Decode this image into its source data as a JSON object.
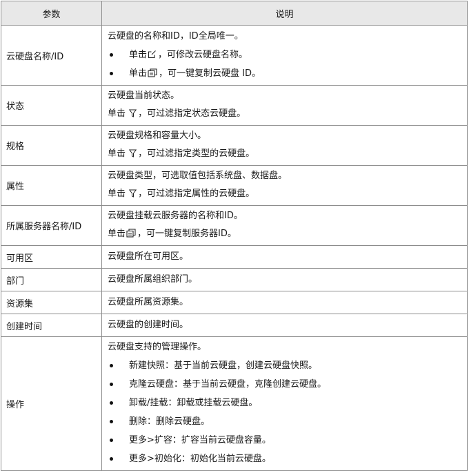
{
  "header": {
    "param": "参数",
    "desc": "说明"
  },
  "rows": [
    {
      "param": "云硬盘名称/ID",
      "lines": [
        {
          "text": "云硬盘的名称和ID，ID全局唯一。"
        }
      ],
      "bullets": [
        {
          "pre": "单击",
          "icon": "edit-icon",
          "post": "，可修改云硬盘名称。"
        },
        {
          "pre": "单击",
          "icon": "copy-icon",
          "post": "，可一键复制云硬盘 ID。"
        }
      ]
    },
    {
      "param": "状态",
      "lines": [
        {
          "text": "云硬盘当前状态。"
        },
        {
          "pre": "单击 ",
          "icon": "filter-icon",
          "post": "，可过滤指定状态云硬盘。"
        }
      ]
    },
    {
      "param": "规格",
      "lines": [
        {
          "text": "云硬盘规格和容量大小。"
        },
        {
          "pre": "单击 ",
          "icon": "filter-icon",
          "post": "，可过滤指定类型的云硬盘。"
        }
      ]
    },
    {
      "param": "属性",
      "lines": [
        {
          "text": "云硬盘类型，可选取值包括系统盘、数据盘。"
        },
        {
          "pre": "单击 ",
          "icon": "filter-icon",
          "post": "，可过滤指定属性的云硬盘。"
        }
      ]
    },
    {
      "param": "所属服务器名称/ID",
      "lines": [
        {
          "text": "云硬盘挂载云服务器的名称和ID。"
        },
        {
          "pre": "单击",
          "icon": "copy-icon",
          "post": "，可一键复制服务器ID。"
        }
      ]
    },
    {
      "param": "可用区",
      "lines": [
        {
          "text": "云硬盘所在可用区。"
        }
      ]
    },
    {
      "param": "部门",
      "lines": [
        {
          "text": "云硬盘所属组织部门。"
        }
      ]
    },
    {
      "param": "资源集",
      "lines": [
        {
          "text": "云硬盘所属资源集。"
        }
      ]
    },
    {
      "param": "创建时间",
      "lines": [
        {
          "text": "云硬盘的创建时间。"
        }
      ]
    },
    {
      "param": "操作",
      "lines": [
        {
          "text": "云硬盘支持的管理操作。"
        }
      ],
      "bullets": [
        {
          "text": "新建快照：基于当前云硬盘，创建云硬盘快照。"
        },
        {
          "text": "克隆云硬盘：基于当前云硬盘，克隆创建云硬盘。"
        },
        {
          "text": "卸载/挂载：卸载或挂载云硬盘。"
        },
        {
          "text": "删除：删除云硬盘。"
        },
        {
          "text": "更多>扩容：扩容当前云硬盘容量。"
        },
        {
          "text": "更多>初始化：初始化当前云硬盘。"
        }
      ]
    }
  ]
}
